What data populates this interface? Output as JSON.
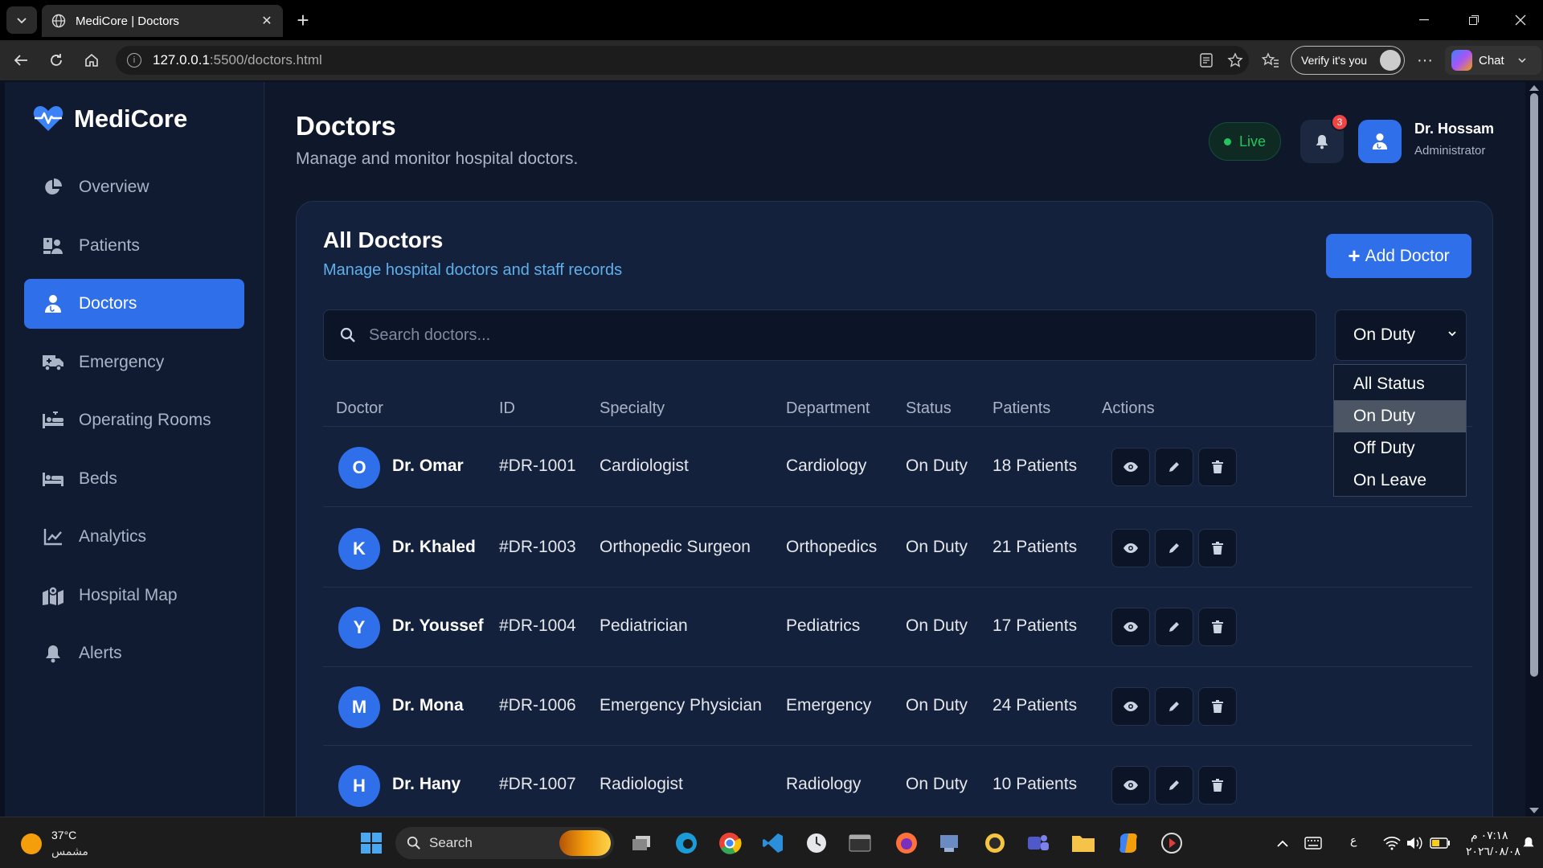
{
  "browser": {
    "tab_title": "MediCore | Doctors",
    "url_host": "127.0.0.1",
    "url_rest": ":5500/doctors.html",
    "verify_label": "Verify it's you",
    "chat_label": "Chat"
  },
  "sidebar": {
    "brand": "MediCore",
    "items": [
      {
        "label": "Overview",
        "icon": "chart-pie-icon"
      },
      {
        "label": "Patients",
        "icon": "hospital-user-icon"
      },
      {
        "label": "Doctors",
        "icon": "user-doctor-icon",
        "active": true
      },
      {
        "label": "Emergency",
        "icon": "ambulance-icon"
      },
      {
        "label": "Operating Rooms",
        "icon": "procedures-icon"
      },
      {
        "label": "Beds",
        "icon": "bed-icon"
      },
      {
        "label": "Analytics",
        "icon": "chart-line-icon"
      },
      {
        "label": "Hospital Map",
        "icon": "map-icon"
      },
      {
        "label": "Alerts",
        "icon": "bell-icon"
      }
    ]
  },
  "header": {
    "title": "Doctors",
    "subtitle": "Manage and monitor hospital doctors.",
    "live_label": "Live",
    "notification_count": "3",
    "user_name": "Dr. Hossam",
    "user_role": "Administrator"
  },
  "card": {
    "title": "All Doctors",
    "subtitle": "Manage hospital doctors and staff records",
    "add_button": "Add Doctor",
    "search_placeholder": "Search doctors...",
    "status_selected": "On Duty",
    "status_options": [
      "All Status",
      "On Duty",
      "Off Duty",
      "On Leave"
    ]
  },
  "table": {
    "columns": [
      "Doctor",
      "ID",
      "Specialty",
      "Department",
      "Status",
      "Patients",
      "Actions"
    ],
    "rows": [
      {
        "initial": "O",
        "name": "Dr. Omar",
        "id": "#DR-1001",
        "specialty": "Cardiologist",
        "department": "Cardiology",
        "status": "On Duty",
        "patients": "18 Patients"
      },
      {
        "initial": "K",
        "name": "Dr. Khaled",
        "id": "#DR-1003",
        "specialty": "Orthopedic Surgeon",
        "department": "Orthopedics",
        "status": "On Duty",
        "patients": "21 Patients"
      },
      {
        "initial": "Y",
        "name": "Dr. Youssef",
        "id": "#DR-1004",
        "specialty": "Pediatrician",
        "department": "Pediatrics",
        "status": "On Duty",
        "patients": "17 Patients"
      },
      {
        "initial": "M",
        "name": "Dr. Mona",
        "id": "#DR-1006",
        "specialty": "Emergency Physician",
        "department": "Emergency",
        "status": "On Duty",
        "patients": "24 Patients"
      },
      {
        "initial": "H",
        "name": "Dr. Hany",
        "id": "#DR-1007",
        "specialty": "Radiologist",
        "department": "Radiology",
        "status": "On Duty",
        "patients": "10 Patients"
      }
    ]
  },
  "taskbar": {
    "temperature": "37°C",
    "weather": "مشمس",
    "search_label": "Search",
    "lang": "ع",
    "time": "٠٧:١٨ م",
    "date": "٢٠٢٦/٠٨/٠٨"
  },
  "colors": {
    "accent": "#2f6fea",
    "live": "#22c55e",
    "badge": "#ef4444",
    "link": "#5fb0ea"
  }
}
